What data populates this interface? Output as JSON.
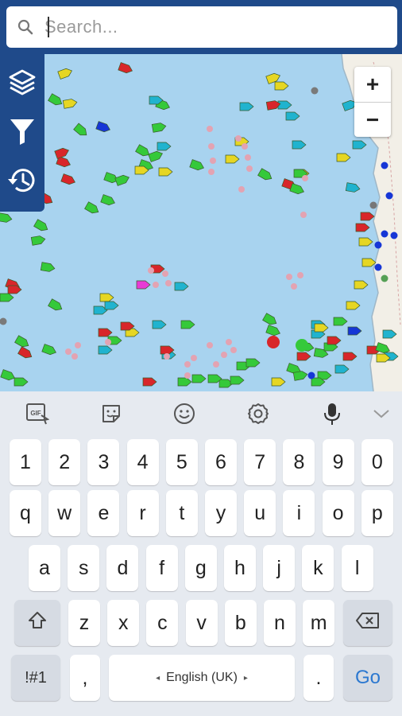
{
  "search": {
    "placeholder": "Search..."
  },
  "side_panel": {
    "items": [
      "layers-icon",
      "filter-icon",
      "history-icon"
    ]
  },
  "zoom": {
    "in_label": "+",
    "out_label": "−"
  },
  "keyboard": {
    "toolbar": [
      "gif-icon",
      "sticker-icon",
      "emoji-icon",
      "settings-icon",
      "microphone-icon",
      "chevron-down-icon"
    ],
    "gif_label": "GIF",
    "numbers": [
      "1",
      "2",
      "3",
      "4",
      "5",
      "6",
      "7",
      "8",
      "9",
      "0"
    ],
    "row1": [
      "q",
      "w",
      "e",
      "r",
      "t",
      "y",
      "u",
      "i",
      "o",
      "p"
    ],
    "row2": [
      "a",
      "s",
      "d",
      "f",
      "g",
      "h",
      "j",
      "k",
      "l"
    ],
    "row3": [
      "z",
      "x",
      "c",
      "v",
      "b",
      "n",
      "m"
    ],
    "symbols_label": "!#1",
    "comma_label": ",",
    "space_label": "English (UK)",
    "period_label": ".",
    "go_label": "Go"
  },
  "colors": {
    "header": "#1f4a8a",
    "sea": "#a8d3ef",
    "land": "#f2efe7",
    "vessel_green": "#35c93a",
    "vessel_red": "#d8262a",
    "vessel_cyan": "#20b3cf",
    "vessel_yellow": "#e6d623",
    "vessel_blue": "#1636d6",
    "vessel_grey": "#8c8c8c",
    "vessel_pink": "#e83bd5",
    "buoy": "#e3a3b2"
  }
}
